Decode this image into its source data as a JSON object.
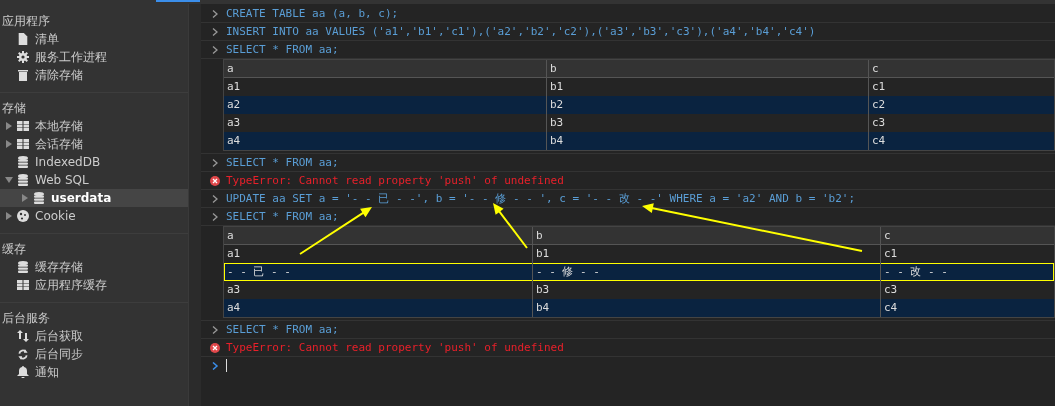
{
  "sidebar": {
    "sections": [
      {
        "title": "应用程序",
        "items": [
          {
            "label": "清单",
            "selected": false
          },
          {
            "label": "服务工作进程",
            "selected": false
          },
          {
            "label": "清除存储",
            "selected": false
          }
        ]
      },
      {
        "title": "存储",
        "items": [
          {
            "label": "本地存储",
            "selected": false,
            "expanded": false
          },
          {
            "label": "会话存储",
            "selected": false,
            "expanded": false
          },
          {
            "label": "IndexedDB",
            "selected": false
          },
          {
            "label": "Web SQL",
            "selected": false,
            "expanded": true,
            "children": [
              {
                "label": "userdata",
                "selected": true,
                "expanded": false
              }
            ]
          },
          {
            "label": "Cookie",
            "selected": false,
            "expanded": false
          }
        ]
      },
      {
        "title": "缓存",
        "items": [
          {
            "label": "缓存存储",
            "selected": false
          },
          {
            "label": "应用程序缓存",
            "selected": false
          }
        ]
      },
      {
        "title": "后台服务",
        "items": [
          {
            "label": "后台获取",
            "selected": false
          },
          {
            "label": "后台同步",
            "selected": false
          },
          {
            "label": "通知",
            "selected": false
          }
        ]
      }
    ]
  },
  "console": {
    "entries": [
      {
        "kind": "input",
        "text": "CREATE TABLE aa (a, b, c);"
      },
      {
        "kind": "input",
        "text": "INSERT INTO aa VALUES ('a1','b1','c1'),('a2','b2','c2'),('a3','b3','c3'),('a4','b4','c4')"
      },
      {
        "kind": "input",
        "text": "SELECT * FROM aa;"
      },
      {
        "kind": "table",
        "columns": [
          "a",
          "b",
          "c"
        ],
        "rows": [
          {
            "cells": [
              "a1",
              "b1",
              "c1"
            ]
          },
          {
            "cells": [
              "a2",
              "b2",
              "c2"
            ]
          },
          {
            "cells": [
              "a3",
              "b3",
              "c3"
            ]
          },
          {
            "cells": [
              "a4",
              "b4",
              "c4"
            ]
          }
        ]
      },
      {
        "kind": "input",
        "text": "SELECT * FROM aa;"
      },
      {
        "kind": "error",
        "text": "TypeError: Cannot read property 'push' of undefined"
      },
      {
        "kind": "input",
        "text": "UPDATE aa SET a = '- - 已 - -', b = '- - 修 - - ', c = '- - 改 - -' WHERE a = 'a2' AND b = 'b2';"
      },
      {
        "kind": "input",
        "text": "SELECT * FROM aa;"
      },
      {
        "kind": "table",
        "columns": [
          "a",
          "b",
          "c"
        ],
        "rows": [
          {
            "cells": [
              "a1",
              "b1",
              "c1"
            ],
            "highlighted": false
          },
          {
            "cells": [
              "- - 已 - -",
              "- - 修 - -",
              "- - 改 - -"
            ],
            "highlighted": true
          },
          {
            "cells": [
              "a3",
              "b3",
              "c3"
            ],
            "highlighted": false
          },
          {
            "cells": [
              "a4",
              "b4",
              "c4"
            ],
            "highlighted": false
          }
        ]
      },
      {
        "kind": "input",
        "text": "SELECT * FROM aa;"
      },
      {
        "kind": "error",
        "text": "TypeError: Cannot read property 'push' of undefined"
      },
      {
        "kind": "prompt"
      }
    ]
  }
}
